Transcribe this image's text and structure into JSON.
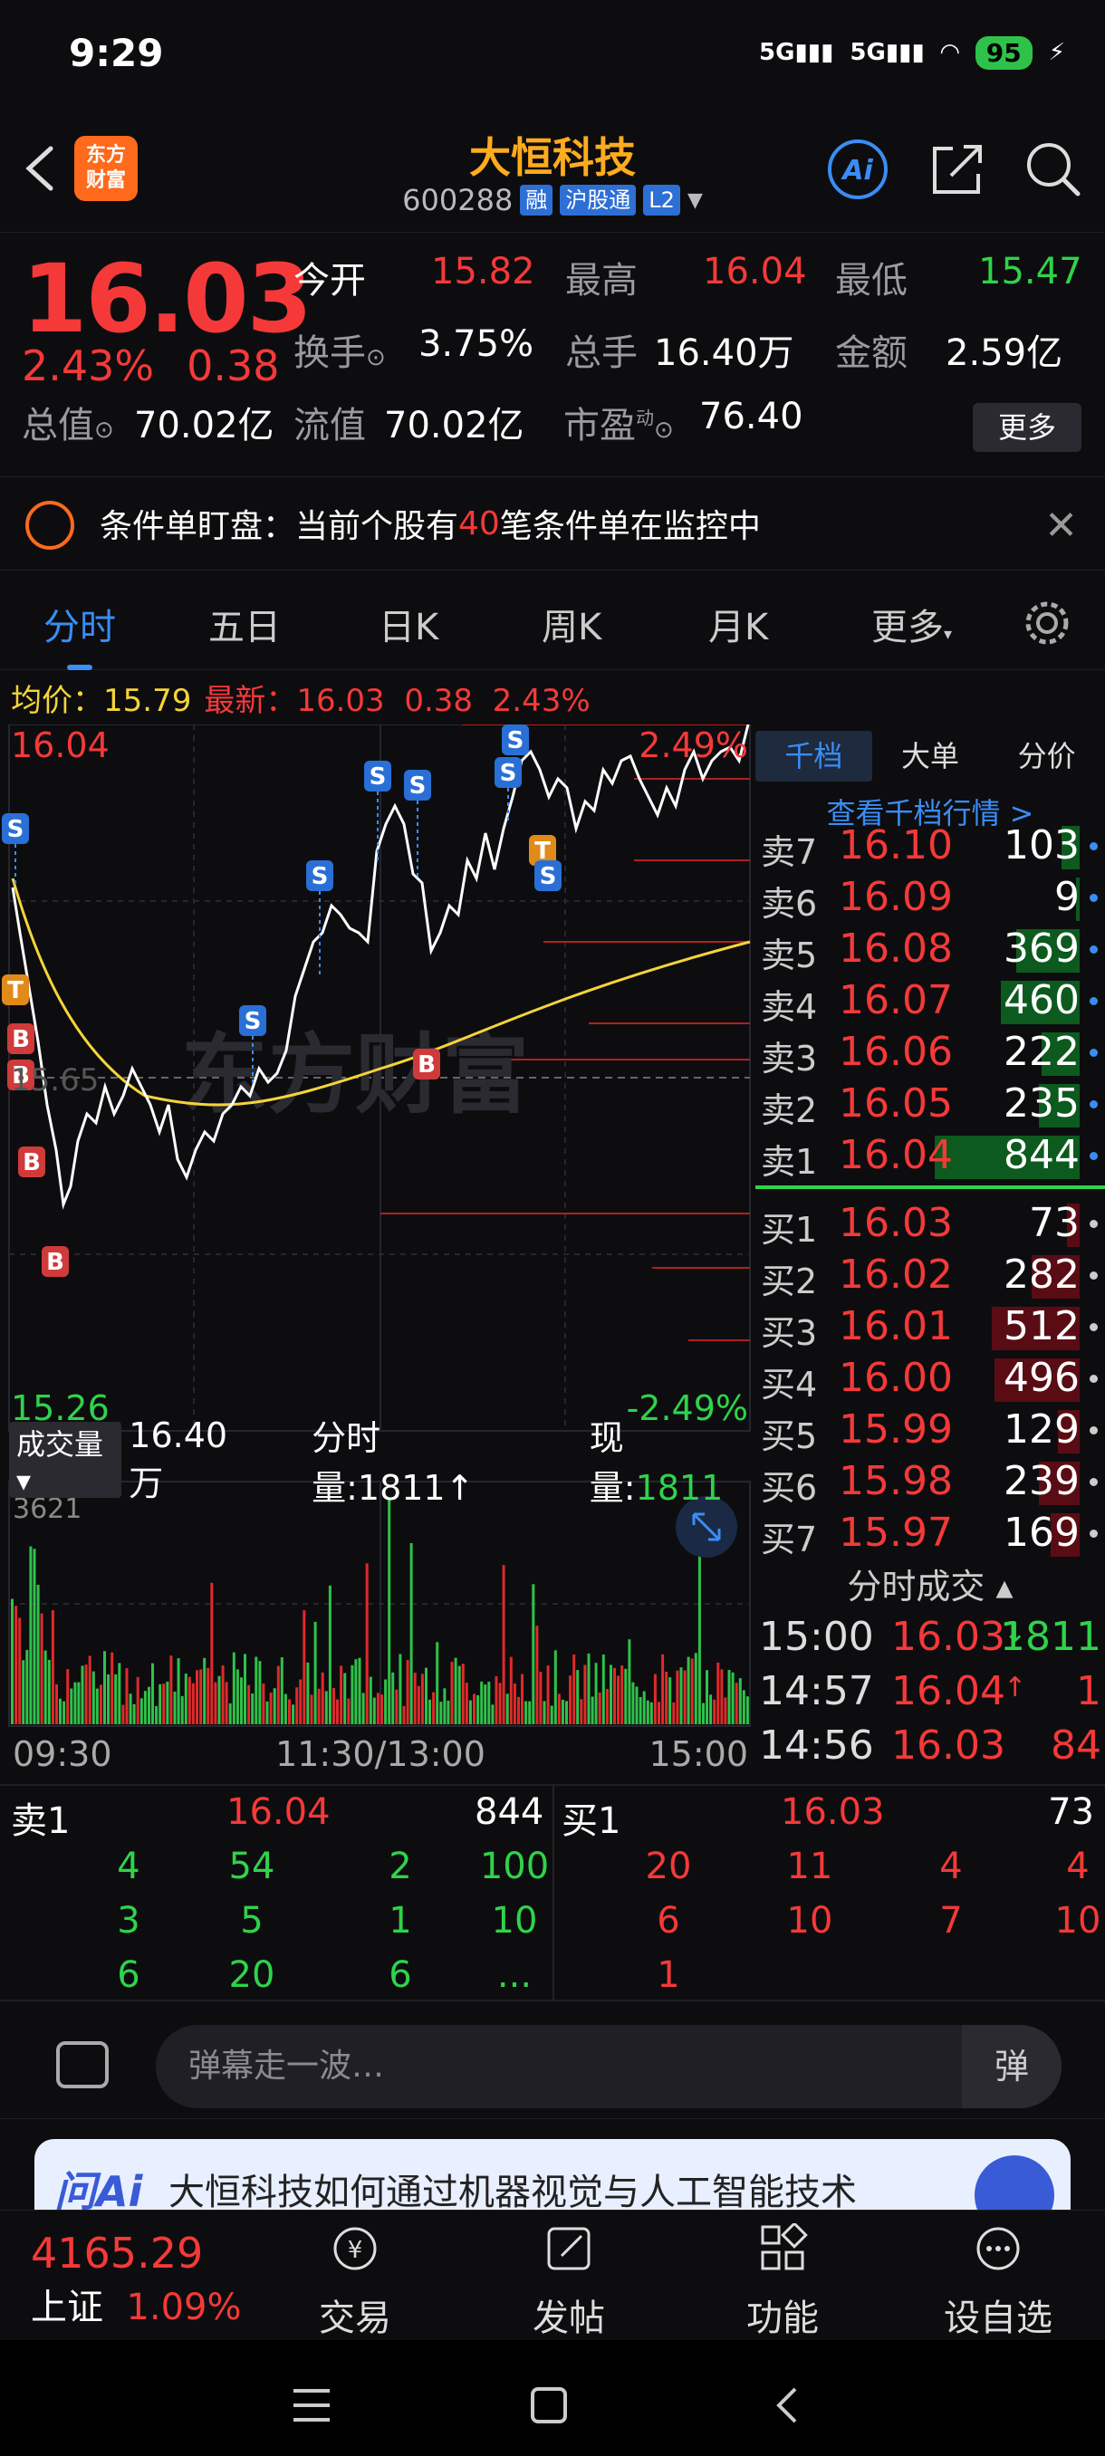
{
  "status": {
    "time": "9:29",
    "signal1": "5G",
    "signal2": "5G",
    "battery": "95"
  },
  "header": {
    "logo_line1": "东方",
    "logo_line2": "财富",
    "title": "大恒科技",
    "code": "600288",
    "tag_rong": "融",
    "tag_hgt": "沪股通",
    "tag_l2": "L2",
    "ai_label": "Ai"
  },
  "quote": {
    "price": "16.03",
    "change_pct": "2.43%",
    "change": "0.38",
    "open_label": "今开",
    "open": "15.82",
    "high_label": "最高",
    "high": "16.04",
    "low_label": "最低",
    "low": "15.47",
    "turnover_label": "换手",
    "turnover": "3.75%",
    "volume_label": "总手",
    "volume": "16.40万",
    "amount_label": "金额",
    "amount": "2.59亿",
    "mktcap_label": "总值",
    "mktcap": "70.02亿",
    "float_label": "流值",
    "float": "70.02亿",
    "pe_label": "市盈",
    "pe_sup": "动",
    "pe": "76.40",
    "more": "更多"
  },
  "alert": {
    "prefix": "条件单盯盘：当前个股有",
    "count": "40",
    "suffix": "笔条件单在监控中"
  },
  "tabs": [
    "分时",
    "五日",
    "日K",
    "周K",
    "月K",
    "更多"
  ],
  "avgline": {
    "avg_label": "均价：",
    "avg": "15.79",
    "last_label": "最新：",
    "last": "16.03",
    "chg": "0.38",
    "pct": "2.43%"
  },
  "chart": {
    "top_price": "16.04",
    "top_pct": "2.49%",
    "mid_price": "15.65",
    "bottom_price": "15.26",
    "bottom_pct": "-2.49%",
    "watermark": "东方财富",
    "markers": [
      "S",
      "S",
      "S",
      "S",
      "S",
      "S",
      "S",
      "T",
      "S",
      "T",
      "B",
      "B",
      "B",
      "B",
      "B"
    ]
  },
  "volume": {
    "label": "成交量",
    "total": "16.40万",
    "tick_label": "分时量:",
    "tick": "1811↑",
    "now_label": "现量:",
    "now": "1811",
    "max": "3621",
    "times": [
      "09:30",
      "11:30/13:00",
      "15:00"
    ]
  },
  "right": {
    "tabs": [
      "千档",
      "大单",
      "分价"
    ],
    "link": "查看千档行情 >",
    "asks": [
      {
        "name": "卖7",
        "price": "16.10",
        "vol": "103"
      },
      {
        "name": "卖6",
        "price": "16.09",
        "vol": "9"
      },
      {
        "name": "卖5",
        "price": "16.08",
        "vol": "369"
      },
      {
        "name": "卖4",
        "price": "16.07",
        "vol": "460"
      },
      {
        "name": "卖3",
        "price": "16.06",
        "vol": "222"
      },
      {
        "name": "卖2",
        "price": "16.05",
        "vol": "235"
      },
      {
        "name": "卖1",
        "price": "16.04",
        "vol": "844"
      }
    ],
    "bids": [
      {
        "name": "买1",
        "price": "16.03",
        "vol": "73"
      },
      {
        "name": "买2",
        "price": "16.02",
        "vol": "282"
      },
      {
        "name": "买3",
        "price": "16.01",
        "vol": "512"
      },
      {
        "name": "买4",
        "price": "16.00",
        "vol": "496"
      },
      {
        "name": "买5",
        "price": "15.99",
        "vol": "129"
      },
      {
        "name": "买6",
        "price": "15.98",
        "vol": "239"
      },
      {
        "name": "买7",
        "price": "15.97",
        "vol": "169"
      }
    ],
    "trades_title": "分时成交",
    "trades": [
      {
        "time": "15:00",
        "price": "16.03",
        "arrow": "↓",
        "vol": "1811"
      },
      {
        "time": "14:57",
        "price": "16.04",
        "arrow": "↑",
        "vol": "1"
      },
      {
        "time": "14:56",
        "price": "16.03",
        "arrow": "",
        "vol": "84"
      }
    ]
  },
  "orders": {
    "sell_label": "卖1",
    "sell_price": "16.04",
    "sell_total": "844",
    "buy_label": "买1",
    "buy_price": "16.03",
    "buy_total": "73",
    "sell_rows": [
      [
        "4",
        "54",
        "2",
        "100"
      ],
      [
        "3",
        "5",
        "1",
        "10"
      ],
      [
        "6",
        "20",
        "6",
        "..."
      ]
    ],
    "buy_rows": [
      [
        "20",
        "11",
        "4",
        "4"
      ],
      [
        "6",
        "10",
        "7",
        "10"
      ],
      [
        "1",
        "",
        "",
        ""
      ]
    ]
  },
  "danmaku": {
    "placeholder": "弹幕走一波…",
    "button": "弹"
  },
  "aibanner": {
    "logo": "问Ai",
    "text": "大恒科技如何通过机器视觉与人工智能技术"
  },
  "bottomnav": {
    "index_value": "4165.29",
    "index_name": "上证",
    "index_pct": "1.09%",
    "items": [
      "交易",
      "发帖",
      "功能",
      "设自选"
    ]
  }
}
